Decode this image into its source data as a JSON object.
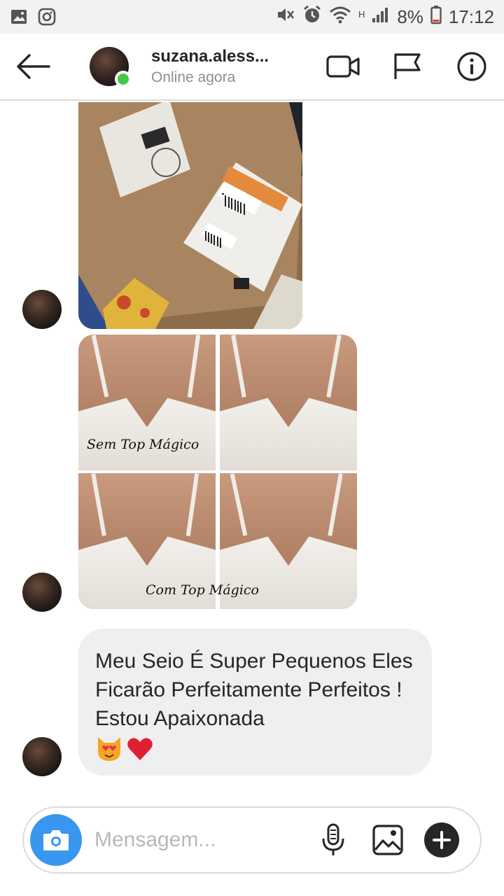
{
  "status_bar": {
    "battery": "8%",
    "time": "17:12",
    "network_type": "H"
  },
  "header": {
    "username": "suzana.aless...",
    "presence": "Online agora"
  },
  "thread": {
    "collage_captions": {
      "before": "Sem Top Mágico",
      "after": "Com Top Mágico"
    },
    "text_message": "Meu Seio É Super Pequenos Eles Ficarão Perfeitamente Perfeitos ! Estou Apaixonada",
    "text_message_emojis": [
      "😻",
      "❤️"
    ]
  },
  "composer": {
    "placeholder": "Mensagem..."
  },
  "colors": {
    "accent_blue": "#3897f0",
    "online_green": "#44c74a",
    "bubble_gray": "#efefef"
  }
}
